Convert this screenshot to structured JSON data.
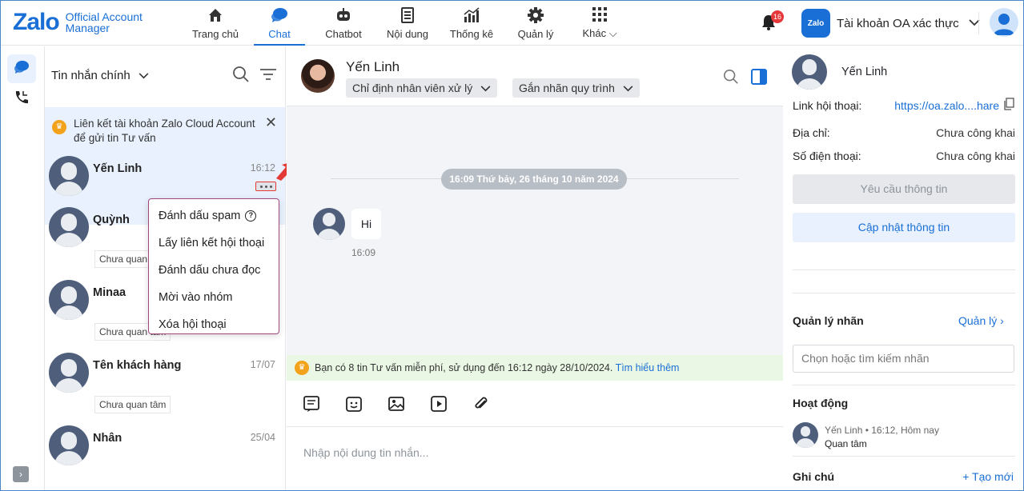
{
  "brand": {
    "logo": "Zalo",
    "line1": "Official Account",
    "line2": "Manager"
  },
  "nav": [
    {
      "label": "Trang chủ",
      "icon": "home-icon"
    },
    {
      "label": "Chat",
      "icon": "chat-icon",
      "active": true
    },
    {
      "label": "Chatbot",
      "icon": "robot-icon"
    },
    {
      "label": "Nội dung",
      "icon": "content-icon"
    },
    {
      "label": "Thống kê",
      "icon": "chart-icon"
    },
    {
      "label": "Quản lý",
      "icon": "gear-icon"
    },
    {
      "label": "Khác",
      "icon": "grid-icon"
    }
  ],
  "notifications": {
    "count": "16"
  },
  "account": {
    "logo_text": "Zalo",
    "name": "Tài khoản OA xác thực"
  },
  "list": {
    "title": "Tin nhắn chính",
    "banner": "Liên kết tài khoản Zalo Cloud Account để gửi tin Tư vấn",
    "conversations": [
      {
        "name": "Yến Linh",
        "time": "16:12",
        "tag": ""
      },
      {
        "name": "Quỳnh",
        "time": "",
        "tag": "Chưa quan tâm"
      },
      {
        "name": "Minaa",
        "time": "",
        "tag": "Chưa quan tâm"
      },
      {
        "name": "Tên khách hàng",
        "time": "17/07",
        "tag": "Chưa quan tâm"
      },
      {
        "name": "Nhân",
        "time": "25/04",
        "tag": ""
      }
    ]
  },
  "context_menu": {
    "items": [
      "Đánh dấu spam",
      "Lấy liên kết hội thoại",
      "Đánh dấu chưa đọc",
      "Mời vào nhóm",
      "Xóa hội thoại"
    ]
  },
  "chat": {
    "name": "Yến Linh",
    "assign": "Chỉ định nhân viên xử lý",
    "rule_tag": "Gắn nhãn quy trình",
    "date": "16:09 Thứ bảy, 26 tháng 10 năm 2024",
    "message": "Hi",
    "message_time": "16:09",
    "free_notice": "Bạn có 8 tin Tư vấn miễn phí, sử dụng đến 16:12 ngày 28/10/2024.",
    "free_link": "Tìm hiểu thêm",
    "composer_placeholder": "Nhập nội dung tin nhắn..."
  },
  "info": {
    "name": "Yến Linh",
    "link_label": "Link hội thoại:",
    "link_value": "https://oa.zalo....hare",
    "address_label": "Địa chỉ:",
    "address_value": "Chưa công khai",
    "phone_label": "Số điện thoại:",
    "phone_value": "Chưa công khai",
    "request_btn": "Yêu cầu thông tin",
    "update_btn": "Cập nhật thông tin",
    "tags_title": "Quản lý nhãn",
    "tags_manage": "Quản lý",
    "tags_search": "Chọn hoặc tìm kiếm nhãn",
    "activity_title": "Hoạt động",
    "activity_user": "Yến Linh",
    "activity_time": "16:12, Hôm nay",
    "activity_value": "Quan tâm",
    "notes_title": "Ghi chú",
    "notes_new": "+ Tạo mới"
  },
  "colors": {
    "accent": "#1a6fd6",
    "badge": "#e5383b",
    "crown": "#f2a31b"
  }
}
